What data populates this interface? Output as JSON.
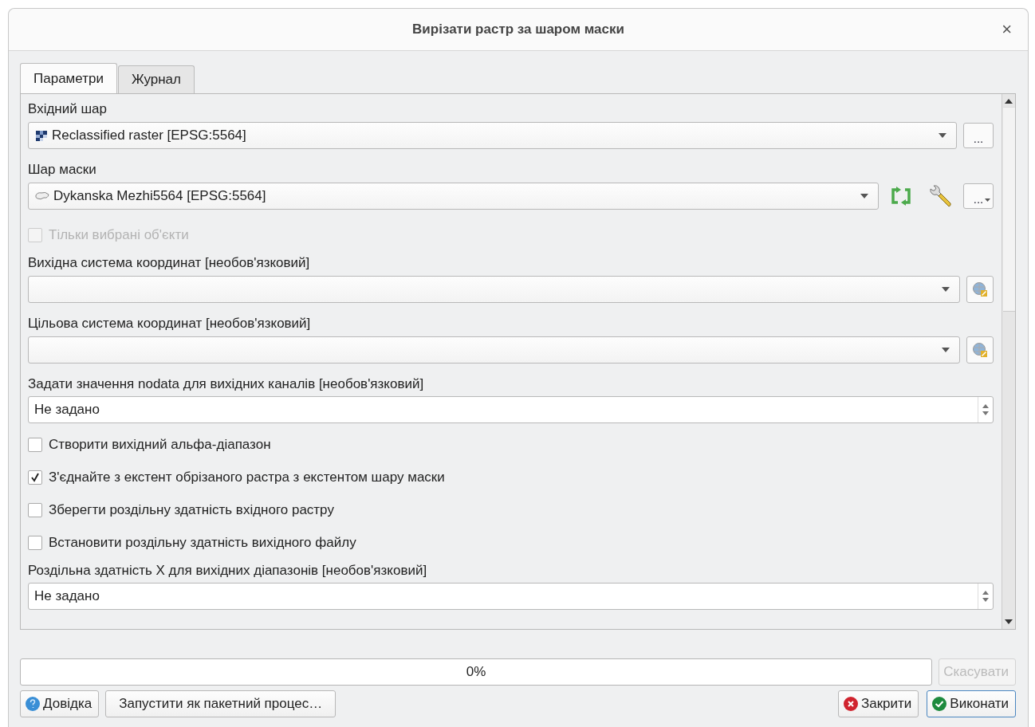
{
  "window": {
    "title": "Вирізати растр за шаром маски",
    "close": "×"
  },
  "tabs": [
    {
      "label": "Параметри",
      "selected": true
    },
    {
      "label": "Журнал",
      "selected": false
    }
  ],
  "parameters": [
    {
      "kind": "label",
      "text": "Вхідний шар"
    },
    {
      "kind": "combo",
      "value": "Reclassified raster [EPSG:5564]",
      "icon": {
        "kind": "raster"
      },
      "actions": [
        {
          "kind": "more",
          "label": "..."
        }
      ]
    },
    {
      "kind": "label",
      "text": "Шар маски"
    },
    {
      "kind": "combo",
      "value": "Dykanska Mezhi5564 [EPSG:5564]",
      "icon": {
        "kind": "polygon"
      },
      "actions": [
        {
          "kind": "iterate"
        },
        {
          "kind": "settings"
        },
        {
          "kind": "more_menu",
          "label": "..."
        }
      ]
    },
    {
      "kind": "checkbox",
      "label": "Тільки вибрані об'єкти",
      "checked": false,
      "disabled": true
    },
    {
      "kind": "label",
      "text": "Вихідна система координат [необов'язковий]"
    },
    {
      "kind": "combo",
      "actions": [
        {
          "kind": "crs"
        }
      ]
    },
    {
      "kind": "label",
      "text": "Цільова система координат [необов'язковий]"
    },
    {
      "kind": "combo",
      "actions": [
        {
          "kind": "crs"
        }
      ]
    },
    {
      "kind": "label",
      "text": "Задати значення nodata для  вихідних каналів [необов'язковий]"
    },
    {
      "kind": "spin",
      "value": "Не задано"
    },
    {
      "kind": "checkbox",
      "label": "Створити вихідний альфа-діапазон",
      "checked": false,
      "disabled": false
    },
    {
      "kind": "checkbox",
      "label": "З'єднайте з екстент обрізаного растра з екстентом шару маски",
      "checked": true,
      "disabled": false
    },
    {
      "kind": "checkbox",
      "label": "Зберегти роздільну здатність вхідного растру",
      "checked": false,
      "disabled": false
    },
    {
      "kind": "checkbox",
      "label": "Встановити роздільну здатність вихідного файлу",
      "checked": false,
      "disabled": false
    },
    {
      "kind": "label",
      "text": "Роздільна здатність X для вихідних діапазонів [необов'язковий]"
    },
    {
      "kind": "spin",
      "value": "Не задано"
    }
  ],
  "progress": {
    "level": 0,
    "reading": "0%"
  },
  "cancel_button": {
    "label": "Скасувати",
    "disabled": true
  },
  "left_buttons": [
    {
      "kind": "help",
      "label": "Довідка"
    },
    {
      "kind": "plain",
      "label": "Запустити як пакетний процес…"
    }
  ],
  "right_buttons": [
    {
      "kind": "close",
      "label": "Закрити",
      "default": false
    },
    {
      "kind": "run",
      "label": "Виконати",
      "default": true
    }
  ]
}
